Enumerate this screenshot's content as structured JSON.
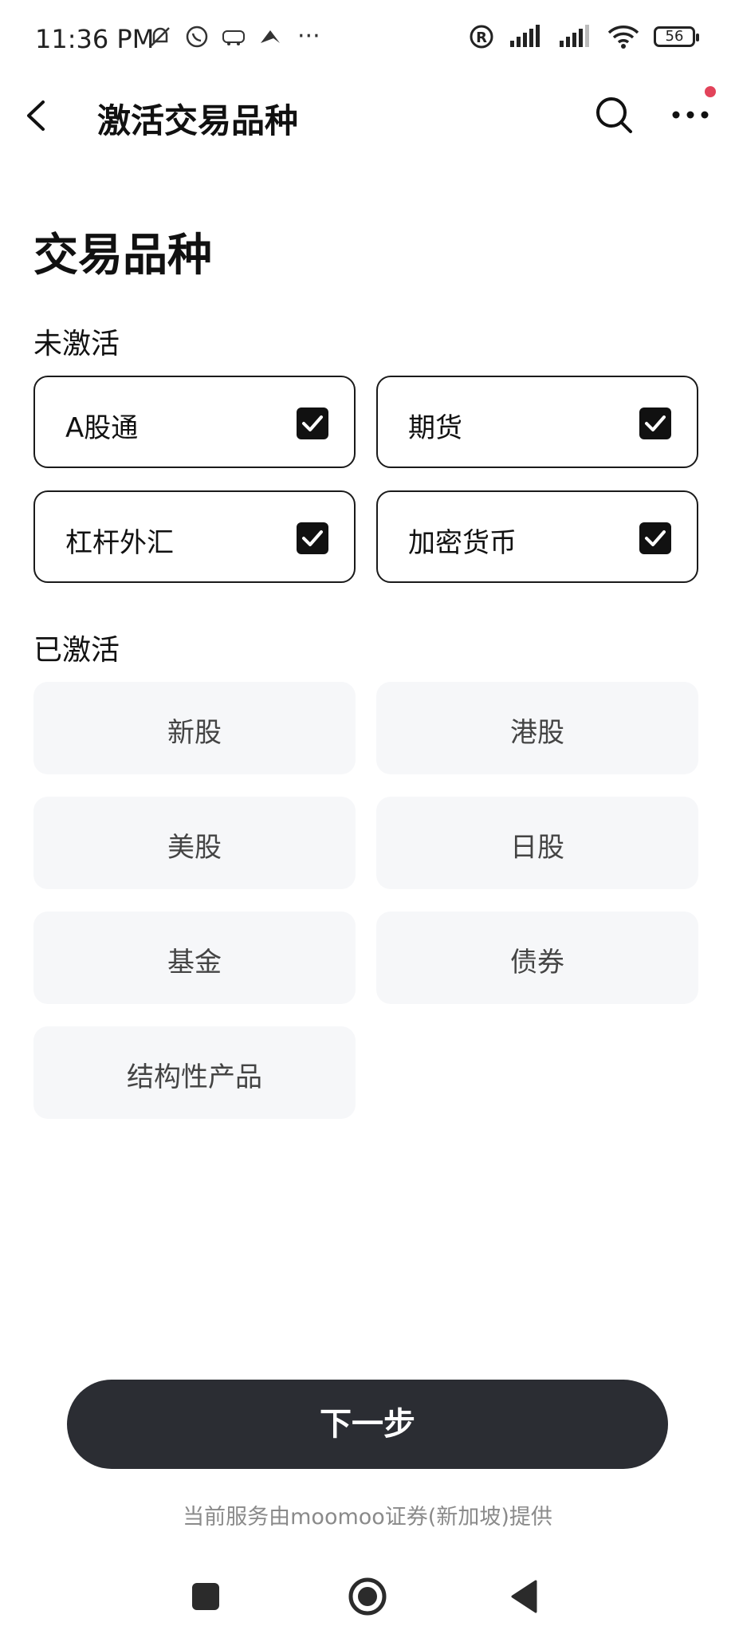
{
  "status_bar": {
    "time": "11:36 PM",
    "battery": "56",
    "icons": [
      "mute-icon",
      "whatsapp-icon",
      "redbus-icon",
      "app-icon",
      "more-dots-icon",
      "registered-icon",
      "signal-icon",
      "signal-icon",
      "wifi-icon",
      "battery-icon"
    ]
  },
  "header": {
    "title": "激活交易品种",
    "back_icon": "back-arrow-icon",
    "search_icon": "search-icon",
    "more_icon": "more-icon",
    "notification_color": "#e2435a"
  },
  "section": {
    "heading": "交易品种",
    "inactive_label": "未激活",
    "active_label": "已激活"
  },
  "inactive_items": [
    {
      "label": "A股通",
      "checked": true
    },
    {
      "label": "期货",
      "checked": true
    },
    {
      "label": "杠杆外汇",
      "checked": true
    },
    {
      "label": "加密货币",
      "checked": true
    }
  ],
  "active_items": [
    {
      "label": "新股"
    },
    {
      "label": "港股"
    },
    {
      "label": "美股"
    },
    {
      "label": "日股"
    },
    {
      "label": "基金"
    },
    {
      "label": "债券"
    },
    {
      "label": "结构性产品"
    }
  ],
  "next_button": "下一步",
  "footer_note": "当前服务由moomoo证券(新加坡)提供",
  "colors": {
    "button_bg": "#2b2d33",
    "active_card_bg": "#f6f7f9",
    "checkbox_bg": "#111111"
  }
}
